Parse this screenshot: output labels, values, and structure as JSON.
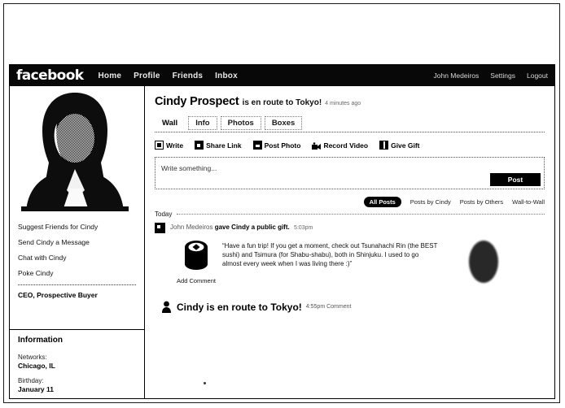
{
  "navbar": {
    "logo": "facebook",
    "links": [
      "Home",
      "Profile",
      "Friends",
      "Inbox"
    ],
    "account_links": [
      "John Medeiros",
      "Settings",
      "Logout"
    ]
  },
  "sidebar": {
    "photo_alt": "profile-photo",
    "links": [
      "Suggest Friends for Cindy",
      "Send Cindy a Message",
      "Chat with Cindy",
      "Poke Cindy"
    ],
    "title": "CEO, Prospective Buyer",
    "information": {
      "heading": "Information",
      "fields": [
        {
          "label": "Networks:",
          "value": "Chicago, IL"
        },
        {
          "label": "Birthday:",
          "value": "January 11"
        }
      ]
    }
  },
  "profile": {
    "name": "Cindy Prospect",
    "status": "is en route to Tokyo!",
    "status_time": "4 minutes ago",
    "tabs": [
      {
        "label": "Wall",
        "active": true
      },
      {
        "label": "Info",
        "active": false
      },
      {
        "label": "Photos",
        "active": false
      },
      {
        "label": "Boxes",
        "active": false
      }
    ]
  },
  "publisher": {
    "actions": [
      {
        "label": "Write",
        "icon": "write-icon"
      },
      {
        "label": "Share Link",
        "icon": "link-icon"
      },
      {
        "label": "Post Photo",
        "icon": "photo-icon"
      },
      {
        "label": "Record Video",
        "icon": "video-camera-icon"
      },
      {
        "label": "Give Gift",
        "icon": "gift-icon"
      }
    ],
    "placeholder": "Write something...",
    "post_label": "Post"
  },
  "filters": [
    {
      "label": "All Posts",
      "active": true
    },
    {
      "label": "Posts by Cindy",
      "active": false
    },
    {
      "label": "Posts by Others",
      "active": false
    },
    {
      "label": "Wall-to-Wall",
      "active": false
    }
  ],
  "feed": {
    "day_label": "Today",
    "gift_story": {
      "actor": "John Medeiros",
      "action": "gave Cindy a public gift.",
      "time": "5:03pm",
      "gift_icon": "sushi-roll-icon",
      "add_comment": "Add Comment",
      "message": "“Have a fun trip! If you get a moment, check out Tsunahachi Rin (the BEST sushi) and Tsimura (for Shabu-shabu), both in Shinjuku. I used to go almost every week when I was living there :)”"
    },
    "status_story": {
      "text": "Cindy is en route to Tokyo!",
      "time": "4:55pm",
      "comment_label": "Comment"
    }
  }
}
